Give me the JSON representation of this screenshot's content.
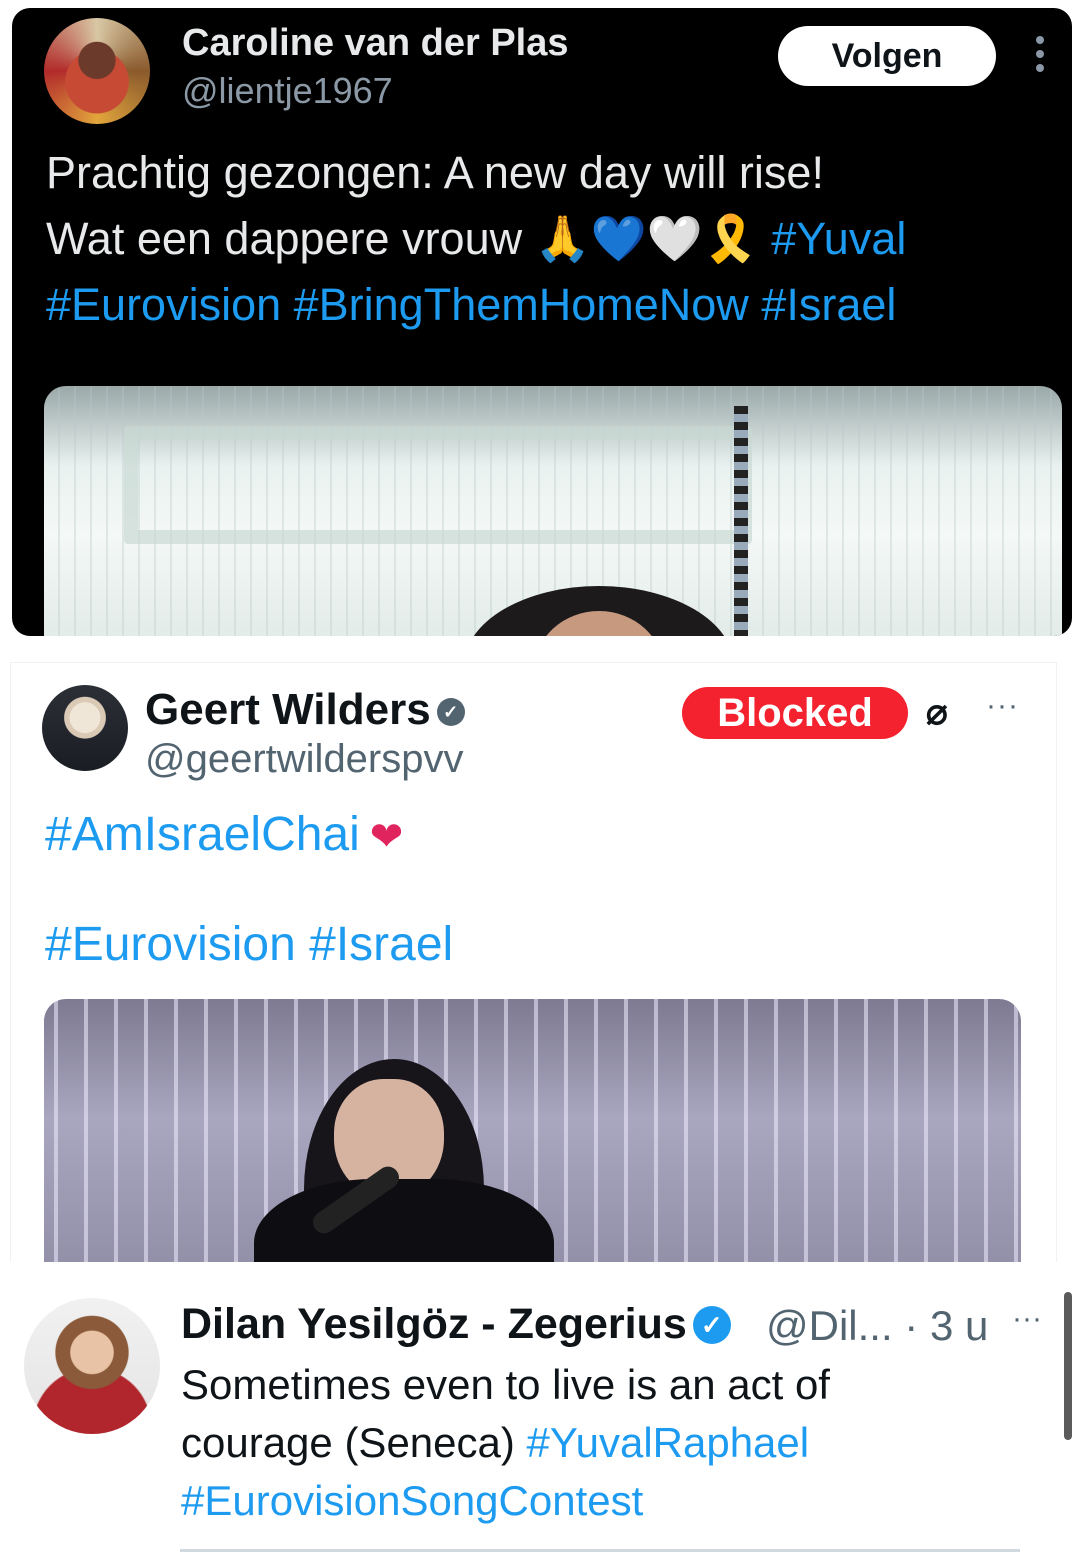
{
  "tweet1": {
    "name": "Caroline van der Plas",
    "handle": "@lientje1967",
    "follow_label": "Volgen",
    "text_line1": "Prachtig gezongen: A new day will rise!",
    "text_line2_plain": "Wat een dappere vrouw 🙏💙🤍🎗️",
    "text_line2_tag": "#Yuval",
    "text_line3": "#Eurovision #BringThemHomeNow #Israel"
  },
  "tweet2": {
    "name": "Geert Wilders",
    "handle": "@geertwilderspvv",
    "blocked_label": "Blocked",
    "unblock_glyph": "⌀",
    "more_glyph": "···",
    "tags_line1": "#AmIsraelChai",
    "heart": "❤",
    "tags_line2": "#Eurovision #Israel"
  },
  "tweet3": {
    "name": "Dilan Yesilgöz - Zegerius",
    "verified_glyph": "✓",
    "meta": "@Dil... · 3 u",
    "more_glyph": "···",
    "text_plain1": "Sometimes even to live is an act of",
    "text_plain2": "courage (Seneca)",
    "tag1": "#YuvalRaphael",
    "tag2": "#EurovisionSongContest"
  },
  "colors": {
    "link": "#1d9bf0",
    "blocked": "#f4212e",
    "dark_bg": "#000000"
  }
}
